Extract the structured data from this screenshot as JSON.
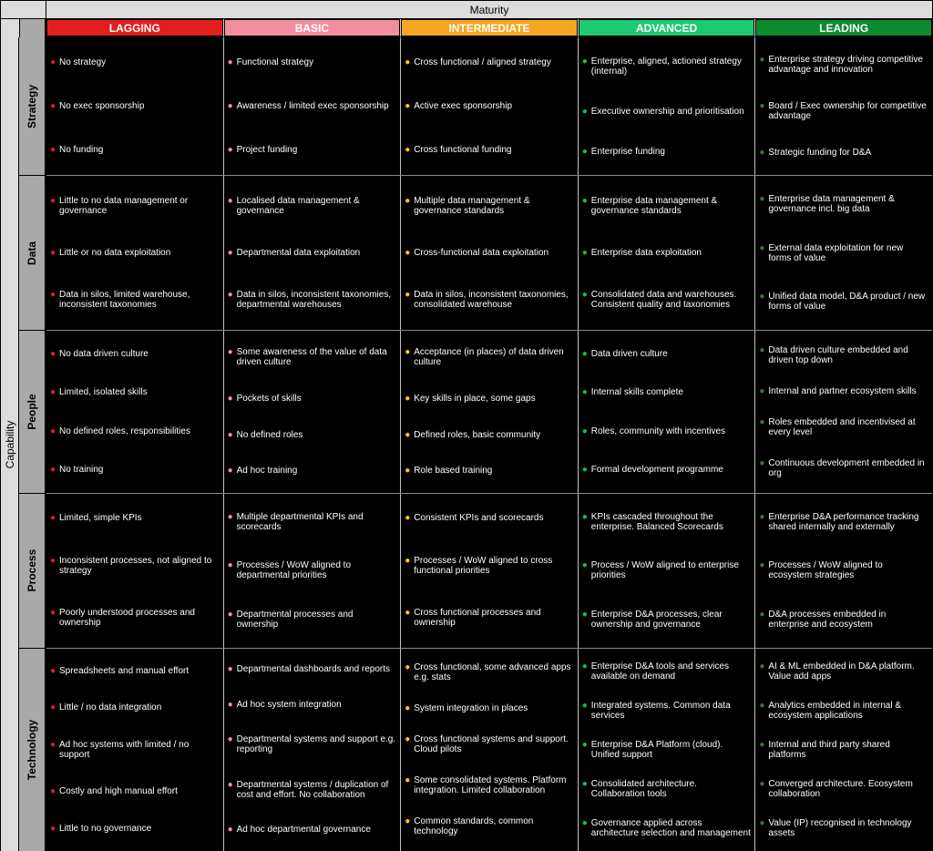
{
  "titles": {
    "maturity": "Maturity",
    "capability": "Capability"
  },
  "columns": [
    "LAGGING",
    "BASIC",
    "INTERMEDIATE",
    "ADVANCED",
    "LEADING"
  ],
  "column_colors": [
    "#e21e1e",
    "#f28ea2",
    "#f5a623",
    "#1ec973",
    "#0b8a2f"
  ],
  "capabilities": [
    "Strategy",
    "Data",
    "People",
    "Process",
    "Technology"
  ],
  "row_heights": [
    0.17,
    0.19,
    0.2,
    0.19,
    0.25
  ],
  "matrix": [
    [
      [
        "No strategy",
        "No exec sponsorship",
        "No funding"
      ],
      [
        "Functional strategy",
        "Awareness / limited exec sponsorship",
        "Project funding"
      ],
      [
        "Cross functional / aligned strategy",
        "Active exec sponsorship",
        "Cross functional funding"
      ],
      [
        "Enterprise, aligned, actioned strategy (internal)",
        "Executive ownership and prioritisation",
        "Enterprise funding"
      ],
      [
        "Enterprise strategy driving competitive advantage and innovation",
        "Board / Exec ownership for competitive advantage",
        "Strategic funding for D&A"
      ]
    ],
    [
      [
        "Little to no data management or governance",
        "Little or no data exploitation",
        "Data in silos, limited warehouse, inconsistent taxonomies"
      ],
      [
        "Localised data management & governance",
        "Departmental data exploitation",
        "Data in silos, inconsistent taxonomies, departmental warehouses"
      ],
      [
        "Multiple data management & governance standards",
        "Cross-functional data exploitation",
        "Data in silos, inconsistent taxonomies, consolidated warehouse"
      ],
      [
        "Enterprise data management & governance standards",
        "Enterprise data exploitation",
        "Consolidated data and warehouses. Consistent quality and taxonomies"
      ],
      [
        "Enterprise data management & governance incl. big data",
        "External data exploitation for new forms of value",
        "Unified data model, D&A product / new forms of value"
      ]
    ],
    [
      [
        "No data driven culture",
        "Limited, isolated skills",
        "No defined roles, responsibilities",
        "No training"
      ],
      [
        "Some awareness of the value of data driven culture",
        "Pockets of skills",
        "No defined roles",
        "Ad hoc training"
      ],
      [
        "Acceptance (in places) of data driven culture",
        "Key skills in place, some gaps",
        "Defined roles, basic community",
        "Role based training"
      ],
      [
        "Data driven culture",
        "Internal skills complete",
        "Roles, community with incentives",
        "Formal development programme"
      ],
      [
        "Data driven culture embedded and driven top down",
        "Internal and partner ecosystem skills",
        "Roles embedded and incentivised at every level",
        "Continuous development embedded in org"
      ]
    ],
    [
      [
        "Limited, simple KPIs",
        "Inconsistent processes, not aligned to strategy",
        "Poorly understood processes and ownership"
      ],
      [
        "Multiple departmental KPIs and scorecards",
        "Processes / WoW aligned to departmental priorities",
        "Departmental processes and ownership"
      ],
      [
        "Consistent KPIs and scorecards",
        "Processes / WoW aligned to cross functional priorities",
        "Cross functional processes and ownership"
      ],
      [
        "KPIs cascaded throughout the enterprise. Balanced Scorecards",
        "Process / WoW aligned to enterprise priorities",
        "Enterprise D&A processes, clear ownership and governance"
      ],
      [
        "Enterprise D&A performance tracking shared internally and externally",
        "Processes / WoW aligned to ecosystem strategies",
        "D&A processes embedded in enterprise and ecosystem"
      ]
    ],
    [
      [
        "Spreadsheets and manual effort",
        "Little / no data integration",
        "Ad hoc systems with limited / no support",
        "Costly and high manual effort",
        "Little to no governance"
      ],
      [
        "Departmental dashboards and reports",
        "Ad hoc system integration",
        "Departmental systems and support e.g. reporting",
        "Departmental systems / duplication of cost and effort. No collaboration",
        "Ad hoc departmental governance"
      ],
      [
        "Cross functional, some advanced apps e.g. stats",
        "System integration in places",
        "Cross functional systems and support. Cloud pilots",
        "Some consolidated systems. Platform integration. Limited collaboration",
        "Common standards, common technology"
      ],
      [
        "Enterprise D&A tools and services available on demand",
        "Integrated systems. Common data services",
        "Enterprise D&A Platform (cloud). Unified support",
        "Consolidated architecture. Collaboration tools",
        "Governance applied across architecture selection and management"
      ],
      [
        "AI & ML embedded in D&A platform. Value add apps",
        "Analytics embedded in internal & ecosystem applications",
        "Internal and third party shared platforms",
        "Converged architecture. Ecosystem collaboration",
        "Value (IP) recognised in technology assets"
      ]
    ]
  ]
}
